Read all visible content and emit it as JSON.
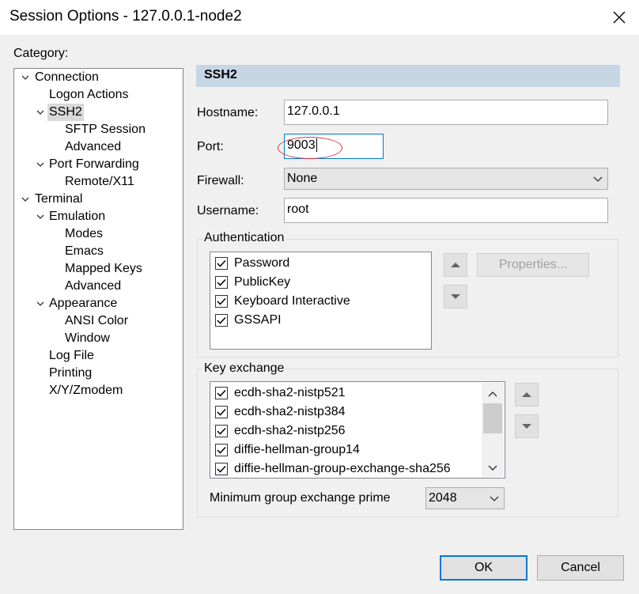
{
  "window": {
    "title": "Session Options - 127.0.0.1-node2",
    "close_icon": "close-icon"
  },
  "category": {
    "label": "Category:",
    "tree": [
      {
        "label": "Connection",
        "expanded": true
      },
      {
        "label": "Logon Actions"
      },
      {
        "label": "SSH2",
        "expanded": true,
        "selected": true
      },
      {
        "label": "SFTP Session"
      },
      {
        "label": "Advanced"
      },
      {
        "label": "Port Forwarding",
        "expanded": true
      },
      {
        "label": "Remote/X11"
      },
      {
        "label": "Terminal",
        "expanded": true
      },
      {
        "label": "Emulation",
        "expanded": true
      },
      {
        "label": "Modes"
      },
      {
        "label": "Emacs"
      },
      {
        "label": "Mapped Keys"
      },
      {
        "label": "Advanced"
      },
      {
        "label": "Appearance",
        "expanded": true
      },
      {
        "label": "ANSI Color"
      },
      {
        "label": "Window"
      },
      {
        "label": "Log File"
      },
      {
        "label": "Printing"
      },
      {
        "label": "X/Y/Zmodem"
      }
    ]
  },
  "panel": {
    "title": "SSH2",
    "hostname": {
      "label": "Hostname:",
      "value": "127.0.0.1"
    },
    "port": {
      "label": "Port:",
      "value": "9003"
    },
    "firewall": {
      "label": "Firewall:",
      "value": "None"
    },
    "username": {
      "label": "Username:",
      "value": "root"
    },
    "authentication": {
      "title": "Authentication",
      "items": [
        {
          "label": "Password",
          "checked": true
        },
        {
          "label": "PublicKey",
          "checked": true
        },
        {
          "label": "Keyboard Interactive",
          "checked": true
        },
        {
          "label": "GSSAPI",
          "checked": true
        }
      ],
      "properties_label": "Properties..."
    },
    "key_exchange": {
      "title": "Key exchange",
      "items": [
        {
          "label": "ecdh-sha2-nistp521",
          "checked": true
        },
        {
          "label": "ecdh-sha2-nistp384",
          "checked": true
        },
        {
          "label": "ecdh-sha2-nistp256",
          "checked": true
        },
        {
          "label": "diffie-hellman-group14",
          "checked": true
        },
        {
          "label": "diffie-hellman-group-exchange-sha256",
          "checked": true
        }
      ],
      "min_prime_label": "Minimum group exchange prime",
      "min_prime_value": "2048"
    }
  },
  "buttons": {
    "ok": "OK",
    "cancel": "Cancel"
  },
  "colors": {
    "accent": "#0078d7",
    "header": "#c7d6e5",
    "annotation": "#e0323a"
  }
}
